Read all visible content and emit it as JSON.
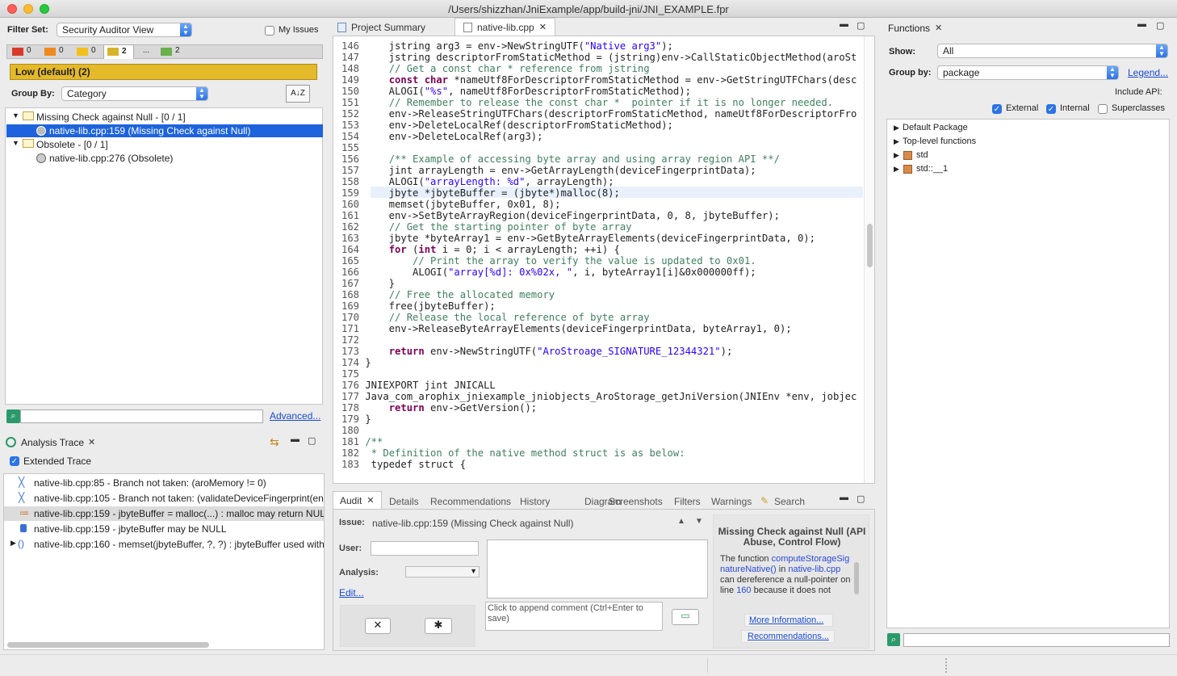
{
  "window": {
    "title": "/Users/shizzhan/JniExample/app/build-jni/JNI_EXAMPLE.fpr"
  },
  "filter": {
    "label": "Filter Set:",
    "value": "Security Auditor View",
    "my_issues": "My Issues",
    "severity_tabs": [
      {
        "count": "0",
        "color": "#d83a2a"
      },
      {
        "count": "0",
        "color": "#f08a1f"
      },
      {
        "count": "0",
        "color": "#f2c01c"
      },
      {
        "count": "2",
        "color": "#d6b42a"
      },
      {
        "count": "...",
        "color": ""
      },
      {
        "count": "2",
        "color": "#6ab04c"
      }
    ],
    "banner": "Low (default) (2)",
    "group_by_label": "Group By:",
    "group_by_value": "Category",
    "sort_icon_label": "A↓Z"
  },
  "issues_tree": [
    {
      "label": "Missing Check against Null - [0 / 1]",
      "children": [
        {
          "label": "native-lib.cpp:159 (Missing Check against Null)",
          "selected": true
        }
      ]
    },
    {
      "label": "Obsolete - [0 / 1]",
      "children": [
        {
          "label": "native-lib.cpp:276 (Obsolete)",
          "selected": false
        }
      ]
    }
  ],
  "search": {
    "advanced": "Advanced..."
  },
  "analysis_trace": {
    "title": "Analysis Trace",
    "extended": "Extended Trace",
    "rows": [
      "native-lib.cpp:85 - Branch not taken: (aroMemory != 0)",
      "native-lib.cpp:105 - Branch not taken: (validateDeviceFingerprint(en",
      "native-lib.cpp:159 - jbyteBuffer = malloc(...) : malloc may return NUL",
      "native-lib.cpp:159 - jbyteBuffer may be NULL",
      "native-lib.cpp:160 - memset(jbyteBuffer, ?, ?) : jbyteBuffer used with"
    ]
  },
  "editor": {
    "tabs": [
      "Project Summary",
      "native-lib.cpp"
    ],
    "lines": [
      {
        "n": "146",
        "t": "    jstring arg3 = env->NewStringUTF(\"Native arg3\");"
      },
      {
        "n": "147",
        "t": "    jstring descriptorFromStaticMethod = (jstring)env->CallStaticObjectMethod(aroSt"
      },
      {
        "n": "148",
        "t": "    // Get a const char * reference from jstring"
      },
      {
        "n": "149",
        "t": "    const char *nameUtf8ForDescriptorFromStaticMethod = env->GetStringUTFChars(desc"
      },
      {
        "n": "150",
        "t": "    ALOGI(\"%s\", nameUtf8ForDescriptorFromStaticMethod);"
      },
      {
        "n": "151",
        "t": "    // Remember to release the const char *  pointer if it is no longer needed."
      },
      {
        "n": "152",
        "t": "    env->ReleaseStringUTFChars(descriptorFromStaticMethod, nameUtf8ForDescriptorFro"
      },
      {
        "n": "153",
        "t": "    env->DeleteLocalRef(descriptorFromStaticMethod);"
      },
      {
        "n": "154",
        "t": "    env->DeleteLocalRef(arg3);"
      },
      {
        "n": "155",
        "t": ""
      },
      {
        "n": "156",
        "t": "    /** Example of accessing byte array and using array region API **/"
      },
      {
        "n": "157",
        "t": "    jint arrayLength = env->GetArrayLength(deviceFingerprintData);"
      },
      {
        "n": "158",
        "t": "    ALOGI(\"arrayLength: %d\", arrayLength);"
      },
      {
        "n": "159",
        "t": "    jbyte *jbyteBuffer = (jbyte*)malloc(8);"
      },
      {
        "n": "160",
        "t": "    memset(jbyteBuffer, 0x01, 8);"
      },
      {
        "n": "161",
        "t": "    env->SetByteArrayRegion(deviceFingerprintData, 0, 8, jbyteBuffer);"
      },
      {
        "n": "162",
        "t": "    // Get the starting pointer of byte array"
      },
      {
        "n": "163",
        "t": "    jbyte *byteArray1 = env->GetByteArrayElements(deviceFingerprintData, 0);"
      },
      {
        "n": "164",
        "t": "    for (int i = 0; i < arrayLength; ++i) {"
      },
      {
        "n": "165",
        "t": "        // Print the array to verify the value is updated to 0x01."
      },
      {
        "n": "166",
        "t": "        ALOGI(\"array[%d]: 0x%02x, \", i, byteArray1[i]&0x000000ff);"
      },
      {
        "n": "167",
        "t": "    }"
      },
      {
        "n": "168",
        "t": "    // Free the allocated memory"
      },
      {
        "n": "169",
        "t": "    free(jbyteBuffer);"
      },
      {
        "n": "170",
        "t": "    // Release the local reference of byte array"
      },
      {
        "n": "171",
        "t": "    env->ReleaseByteArrayElements(deviceFingerprintData, byteArray1, 0);"
      },
      {
        "n": "172",
        "t": ""
      },
      {
        "n": "173",
        "t": "    return env->NewStringUTF(\"AroStroage_SIGNATURE_12344321\");"
      },
      {
        "n": "174",
        "t": "}"
      },
      {
        "n": "175",
        "t": ""
      },
      {
        "n": "176",
        "t": "JNIEXPORT jint JNICALL"
      },
      {
        "n": "177",
        "t": "Java_com_arophix_jniexample_jniobjects_AroStorage_getJniVersion(JNIEnv *env, jobjec"
      },
      {
        "n": "178",
        "t": "    return env->GetVersion();"
      },
      {
        "n": "179",
        "t": "}"
      },
      {
        "n": "180",
        "t": ""
      },
      {
        "n": "181",
        "t": "/**"
      },
      {
        "n": "182",
        "t": " * Definition of the native method struct is as below:"
      },
      {
        "n": "183",
        "t": " typedef struct {"
      }
    ]
  },
  "audit": {
    "tabs": [
      "Audit",
      "Details",
      "Recommendations",
      "History",
      "Diagram",
      "Screenshots",
      "Filters",
      "Warnings",
      "Search"
    ],
    "issue_label": "Issue:",
    "issue_value": "native-lib.cpp:159 (Missing Check against Null)",
    "user_label": "User:",
    "analysis_label": "Analysis:",
    "edit": "Edit...",
    "comment_placeholder": "Click to append comment (Ctrl+Enter to save)",
    "right_title": "Missing Check against Null (API Abuse, Control Flow)",
    "desc_1": "The function",
    "desc_fn": "computeStorageSignatureNative()",
    "desc_2": "in",
    "desc_file": "native-lib.cpp",
    "desc_3": "can dereference a null-pointer on line",
    "desc_line": "160",
    "desc_4": "because it does not",
    "more_info": "More Information...",
    "recommendations": "Recommendations..."
  },
  "functions": {
    "title": "Functions",
    "show_label": "Show:",
    "show_value": "All",
    "group_label": "Group by:",
    "group_value": "package",
    "legend": "Legend...",
    "include_api": "Include API:",
    "external": "External",
    "internal": "Internal",
    "superclasses": "Superclasses",
    "tree": [
      "Default Package",
      "Top-level functions",
      "std",
      "std::__1"
    ]
  }
}
